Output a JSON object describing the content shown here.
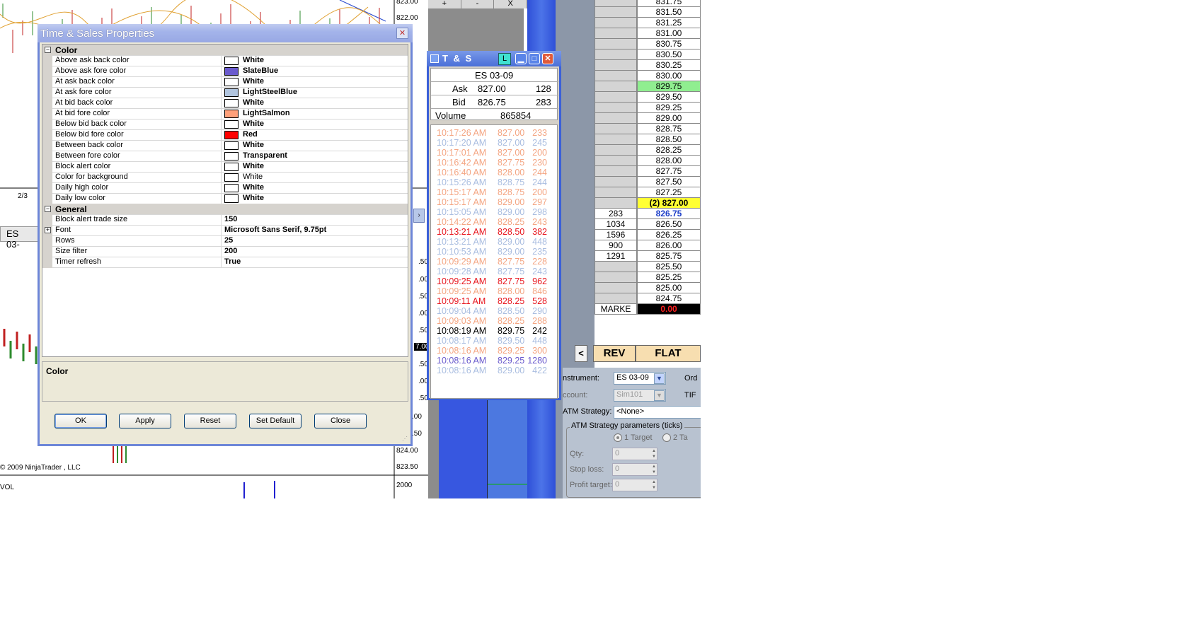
{
  "chart": {
    "price_labels": [
      "823.00",
      "822.00",
      "824.00",
      "823.50",
      "2000"
    ],
    "partial_labels": [
      ".50",
      ".00",
      ".50",
      ".00",
      ".50",
      "7.00",
      ".50",
      ".00",
      ".50",
      ".00",
      ".50"
    ],
    "date_label": "2/3",
    "tab_label": "ES 03-",
    "copyright": "© 2009 NinjaTrader , LLC",
    "vol_label": "VOL",
    "scroll_right": "›"
  },
  "mid_toolbar": [
    "+",
    "-",
    "X"
  ],
  "ladder": {
    "rows": [
      {
        "vol": "",
        "price": "831.75"
      },
      {
        "vol": "",
        "price": "831.50"
      },
      {
        "vol": "",
        "price": "831.25"
      },
      {
        "vol": "",
        "price": "831.00"
      },
      {
        "vol": "",
        "price": "830.75"
      },
      {
        "vol": "",
        "price": "830.50"
      },
      {
        "vol": "",
        "price": "830.25"
      },
      {
        "vol": "",
        "price": "830.00"
      },
      {
        "vol": "",
        "price": "829.75",
        "style": "green"
      },
      {
        "vol": "",
        "price": "829.50"
      },
      {
        "vol": "",
        "price": "829.25"
      },
      {
        "vol": "",
        "price": "829.00"
      },
      {
        "vol": "",
        "price": "828.75"
      },
      {
        "vol": "",
        "price": "828.50"
      },
      {
        "vol": "",
        "price": "828.25"
      },
      {
        "vol": "",
        "price": "828.00"
      },
      {
        "vol": "",
        "price": "827.75"
      },
      {
        "vol": "",
        "price": "827.50"
      },
      {
        "vol": "",
        "price": "827.25"
      },
      {
        "vol": "",
        "price": "(2) 827.00",
        "style": "yellow"
      },
      {
        "vol": "283",
        "price": "826.75",
        "style": "bluebold"
      },
      {
        "vol": "1034",
        "price": "826.50"
      },
      {
        "vol": "1596",
        "price": "826.25"
      },
      {
        "vol": "900",
        "price": "826.00"
      },
      {
        "vol": "1291",
        "price": "825.75"
      },
      {
        "vol": "",
        "price": "825.50"
      },
      {
        "vol": "",
        "price": "825.25"
      },
      {
        "vol": "",
        "price": "825.00"
      },
      {
        "vol": "",
        "price": "824.75"
      }
    ],
    "market_label": "MARKE",
    "market_value": "0.00",
    "lt_button": "<",
    "rev_button": "REV",
    "flat_button": "FLAT"
  },
  "order_entry": {
    "instrument_label": "nstrument:",
    "instrument_value": "ES 03-09",
    "account_label": "ccount:",
    "account_value": "Sim101",
    "ord_label": "Ord",
    "tif_label": "TIF",
    "atm_label": "ATM Strategy:",
    "atm_value": "<None>",
    "atm_group_title": "ATM Strategy parameters (ticks)",
    "radio1": "1 Target",
    "radio2": "2 Ta",
    "qty_label": "Qty:",
    "qty_value": "0",
    "stop_label": "Stop loss:",
    "stop_value": "0",
    "profit_label": "Profit target:",
    "profit_value": "0"
  },
  "ts_window": {
    "title": "T & S",
    "l_button": "L",
    "instrument": "ES 03-09",
    "ask_label": "Ask",
    "ask_price": "827.00",
    "ask_size": "128",
    "bid_label": "Bid",
    "bid_price": "826.75",
    "bid_size": "283",
    "volume_label": "Volume",
    "volume_value": "865854",
    "trades": [
      {
        "time": "10:17:26 AM",
        "price": "827.00",
        "size": "233",
        "color": "#f4a582"
      },
      {
        "time": "10:17:20 AM",
        "price": "827.00",
        "size": "245",
        "color": "#a9bde0"
      },
      {
        "time": "10:17:01 AM",
        "price": "827.00",
        "size": "200",
        "color": "#f4a582"
      },
      {
        "time": "10:16:42 AM",
        "price": "827.75",
        "size": "230",
        "color": "#f4a582"
      },
      {
        "time": "10:16:40 AM",
        "price": "828.00",
        "size": "244",
        "color": "#f4a582"
      },
      {
        "time": "10:15:26 AM",
        "price": "828.75",
        "size": "244",
        "color": "#a9bde0"
      },
      {
        "time": "10:15:17 AM",
        "price": "828.75",
        "size": "200",
        "color": "#f4a582"
      },
      {
        "time": "10:15:17 AM",
        "price": "829.00",
        "size": "297",
        "color": "#f4a582"
      },
      {
        "time": "10:15:05 AM",
        "price": "829.00",
        "size": "298",
        "color": "#a9bde0"
      },
      {
        "time": "10:14:22 AM",
        "price": "828.25",
        "size": "243",
        "color": "#f4a582"
      },
      {
        "time": "10:13:21 AM",
        "price": "828.50",
        "size": "382",
        "color": "#e8141c"
      },
      {
        "time": "10:13:21 AM",
        "price": "829.00",
        "size": "448",
        "color": "#a9bde0"
      },
      {
        "time": "10:10:53 AM",
        "price": "829.00",
        "size": "235",
        "color": "#a9bde0"
      },
      {
        "time": "10:09:29 AM",
        "price": "827.75",
        "size": "228",
        "color": "#f4a582"
      },
      {
        "time": "10:09:28 AM",
        "price": "827.75",
        "size": "243",
        "color": "#a9bde0"
      },
      {
        "time": "10:09:25 AM",
        "price": "827.75",
        "size": "962",
        "color": "#e8141c"
      },
      {
        "time": "10:09:25 AM",
        "price": "828.00",
        "size": "846",
        "color": "#f4a582"
      },
      {
        "time": "10:09:11 AM",
        "price": "828.25",
        "size": "528",
        "color": "#e8141c"
      },
      {
        "time": "10:09:04 AM",
        "price": "828.50",
        "size": "290",
        "color": "#a9bde0"
      },
      {
        "time": "10:09:03 AM",
        "price": "828.25",
        "size": "288",
        "color": "#f4a582"
      },
      {
        "time": "10:08:19 AM",
        "price": "829.75",
        "size": "242",
        "color": "#000000"
      },
      {
        "time": "10:08:17 AM",
        "price": "829.50",
        "size": "448",
        "color": "#a9bde0"
      },
      {
        "time": "10:08:16 AM",
        "price": "829.25",
        "size": "300",
        "color": "#f4a582"
      },
      {
        "time": "10:08:16 AM",
        "price": "829.25",
        "size": "1280",
        "color": "#6a5acd"
      },
      {
        "time": "10:08:16 AM",
        "price": "829.00",
        "size": "422",
        "color": "#a9bde0"
      }
    ]
  },
  "dialog": {
    "title": "Time & Sales Properties",
    "color_category": "Color",
    "general_category": "General",
    "color_props": [
      {
        "name": "Above ask back color",
        "value": "White",
        "swatch": "#ffffff"
      },
      {
        "name": "Above ask fore color",
        "value": "SlateBlue",
        "swatch": "#6a5acd"
      },
      {
        "name": "At ask back color",
        "value": "White",
        "swatch": "#ffffff"
      },
      {
        "name": "At ask fore color",
        "value": "LightSteelBlue",
        "swatch": "#b0c4de"
      },
      {
        "name": "At bid back color",
        "value": "White",
        "swatch": "#ffffff"
      },
      {
        "name": "At bid fore color",
        "value": "LightSalmon",
        "swatch": "#ffa07a"
      },
      {
        "name": "Below bid back color",
        "value": "White",
        "swatch": "#ffffff"
      },
      {
        "name": "Below bid fore color",
        "value": "Red",
        "swatch": "#ff0000"
      },
      {
        "name": "Between back color",
        "value": "White",
        "swatch": "#ffffff"
      },
      {
        "name": "Between fore color",
        "value": "Transparent",
        "swatch": "#ffffff"
      },
      {
        "name": "Block alert color",
        "value": "White",
        "swatch": "#ffffff"
      },
      {
        "name": "Color for background",
        "value": "White",
        "swatch": "#ffffff",
        "normal": true
      },
      {
        "name": "Daily high color",
        "value": "White",
        "swatch": "#ffffff"
      },
      {
        "name": "Daily low color",
        "value": "White",
        "swatch": "#ffffff"
      }
    ],
    "general_props": [
      {
        "name": "Block alert trade size",
        "value": "150"
      },
      {
        "name": "Font",
        "value": "Microsoft Sans Serif, 9.75pt",
        "expandable": true
      },
      {
        "name": "Rows",
        "value": "25"
      },
      {
        "name": "Size filter",
        "value": "200"
      },
      {
        "name": "Timer refresh",
        "value": "True"
      }
    ],
    "help_title": "Color",
    "buttons": {
      "ok": "OK",
      "apply": "Apply",
      "reset": "Reset",
      "set_default": "Set Default",
      "close": "Close"
    }
  }
}
